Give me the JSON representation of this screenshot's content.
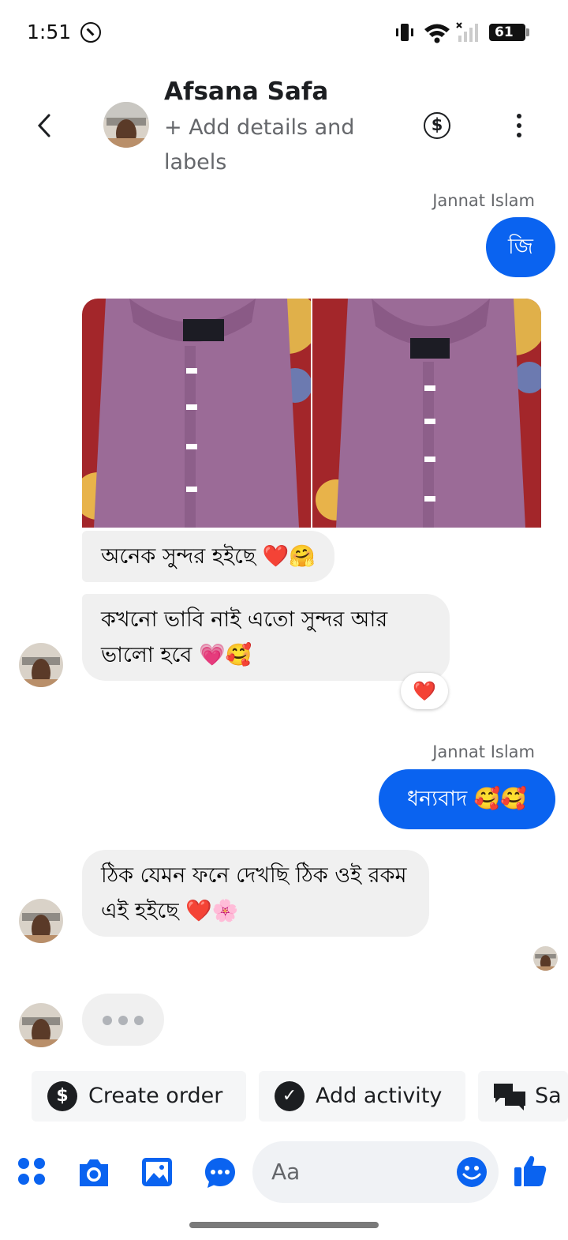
{
  "status_bar": {
    "time": "1:51",
    "battery": "61"
  },
  "header": {
    "contact_name": "Afsana Safa",
    "subtitle": "+ Add details and labels",
    "dollar_icon": "$"
  },
  "messages": {
    "sender_1": "Jannat Islam",
    "out_1": "জি",
    "in_1": "অনেক সুন্দর হইছে ❤️🤗",
    "in_2": "কখনো ভাবি নাই এতো সুন্দর আর ভালো হবে 💗🥰",
    "reaction": "❤️",
    "sender_2": "Jannat Islam",
    "out_2": "ধন্যবাদ 🥰🥰",
    "in_3": "ঠিক যেমন ফনে দেখছি ঠিক ওই রকম এই হইছে ❤️🌸"
  },
  "quick_actions": {
    "create_order": "Create order",
    "add_activity": "Add activity",
    "saved": "Sa"
  },
  "composer": {
    "placeholder": "Aa"
  },
  "colors": {
    "accent": "#0a63f0",
    "incoming_bubble": "#f0f0f0"
  },
  "icons": [
    "back-icon",
    "dollar-icon",
    "more-icon",
    "apps-icon",
    "camera-icon",
    "gallery-icon",
    "chat-bubble-icon",
    "emoji-icon",
    "thumbs-up-icon"
  ]
}
